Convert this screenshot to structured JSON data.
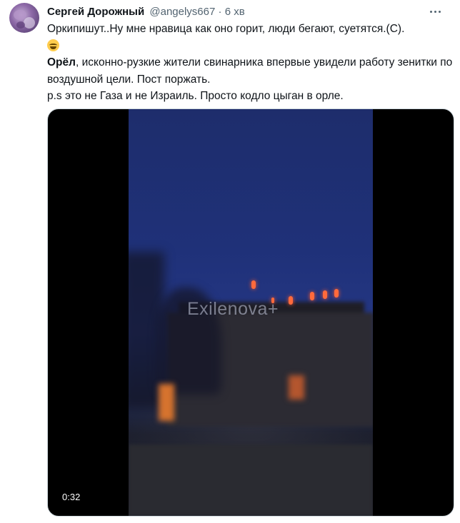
{
  "tweet": {
    "author_name": "Сергей Дорожный",
    "author_handle": "@angelys667",
    "separator": "·",
    "time": "6 хв",
    "line1": "Оркипишут..Ну мне нравица как оно горит, люди бегают, суетятся.(С).",
    "line2_bold": "Орёл",
    "line2_rest": ", исконно-рузкие жители свинарника впервые увидели работу зенитки по воздушной цели. Пост поржать.",
    "line3": "p.s это не Газа и не Израиль. Просто кодло цыган в орле."
  },
  "media": {
    "watermark": "Exilenova+",
    "duration": "0:32"
  },
  "icons": {
    "more": "more-horizontal-icon",
    "emoji": "face-with-tears-of-joy-emoji",
    "avatar": "user-avatar"
  }
}
